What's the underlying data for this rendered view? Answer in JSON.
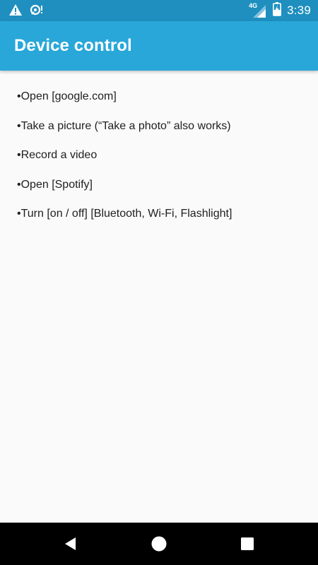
{
  "status_bar": {
    "network_label": "4G",
    "time": "3:39",
    "icons": [
      "warning-icon",
      "sync-alert-icon",
      "signal-icon",
      "battery-charging-icon"
    ]
  },
  "app_bar": {
    "title": "Device control"
  },
  "commands": [
    {
      "text": "•Open [google.com]"
    },
    {
      "text": "•Take a picture (“Take a photo” also works)"
    },
    {
      "text": "•Record a video"
    },
    {
      "text": "•Open [Spotify]"
    },
    {
      "text": "•Turn [on / off] [Bluetooth, Wi-Fi, Flashlight]"
    }
  ],
  "nav_bar": {
    "buttons": [
      "back-icon",
      "home-icon",
      "recents-icon"
    ]
  },
  "colors": {
    "status_bar": "#1e8fbf",
    "app_bar": "#29a7d9",
    "background": "#fafafa",
    "text": "#212121",
    "nav_bar": "#000000"
  }
}
